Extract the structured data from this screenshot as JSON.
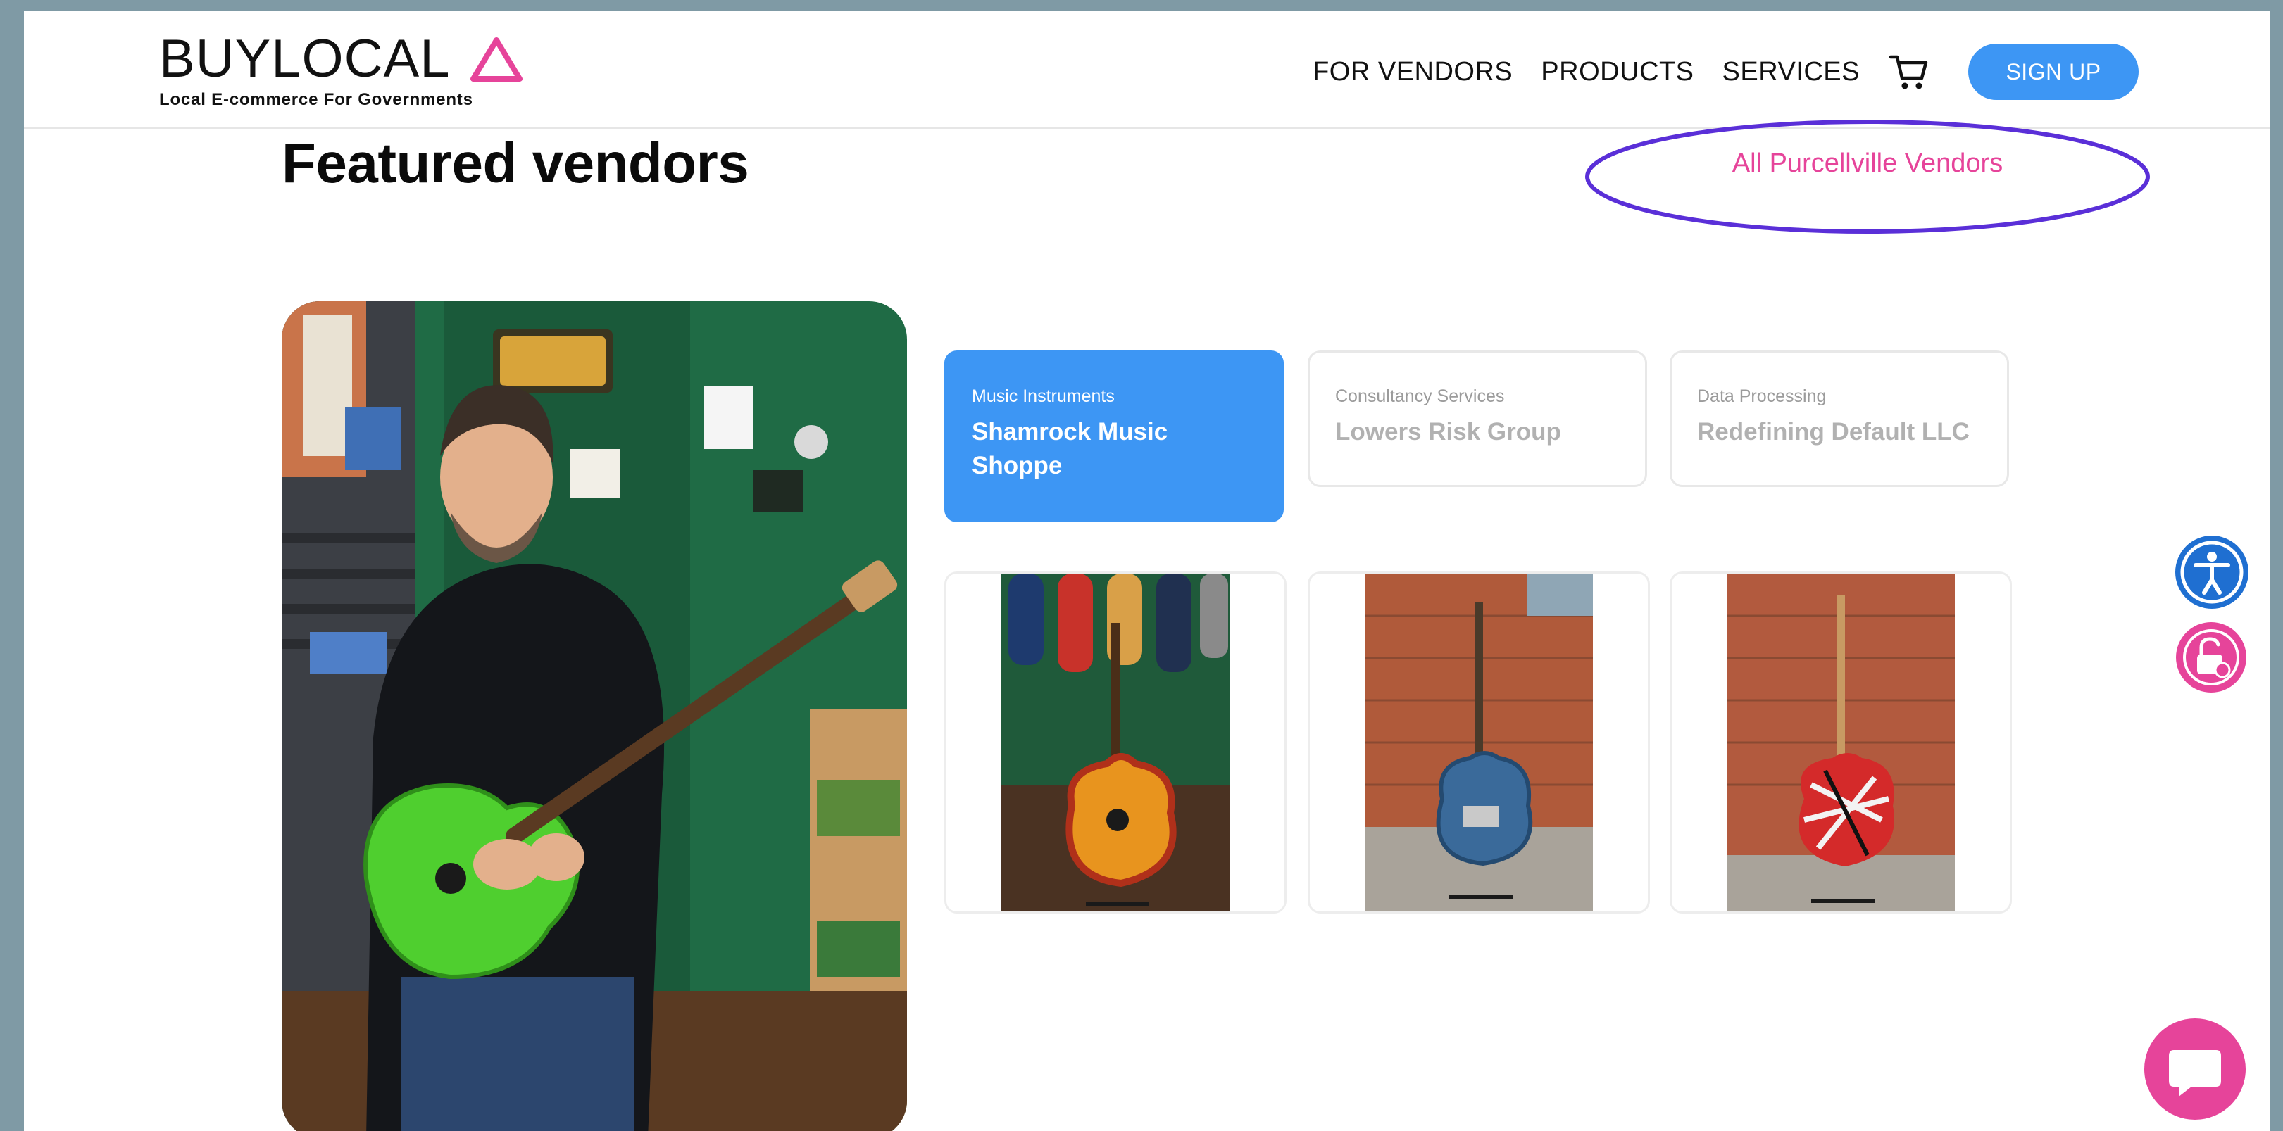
{
  "header": {
    "logo_text": "BUYLOCAL",
    "logo_tagline": "Local E-commerce For Governments",
    "nav_links": [
      "FOR VENDORS",
      "PRODUCTS",
      "SERVICES"
    ],
    "signup_label": "SIGN UP"
  },
  "section": {
    "title": "Featured vendors",
    "all_vendors_link": "All Purcellville Vendors"
  },
  "vendors": [
    {
      "category": "Music Instruments",
      "name": "Shamrock Music Shoppe",
      "active": true
    },
    {
      "category": "Consultancy Services",
      "name": "Lowers Risk Group",
      "active": false
    },
    {
      "category": "Data Processing",
      "name": "Redefining Default LLC",
      "active": false
    }
  ],
  "products": [
    {
      "icon": "sunburst-guitar-image"
    },
    {
      "icon": "blue-guitar-image"
    },
    {
      "icon": "striped-guitar-image"
    }
  ],
  "colors": {
    "accent_blue": "#3d96f4",
    "accent_pink": "#e6449a",
    "highlight_ellipse": "#5a2fd8",
    "accessibility_blue": "#1f6fd1"
  },
  "icons": {
    "cart": "cart-icon",
    "accessibility": "accessibility-icon",
    "privacy": "unlock-shield-icon",
    "chat": "chat-bubble-icon"
  }
}
